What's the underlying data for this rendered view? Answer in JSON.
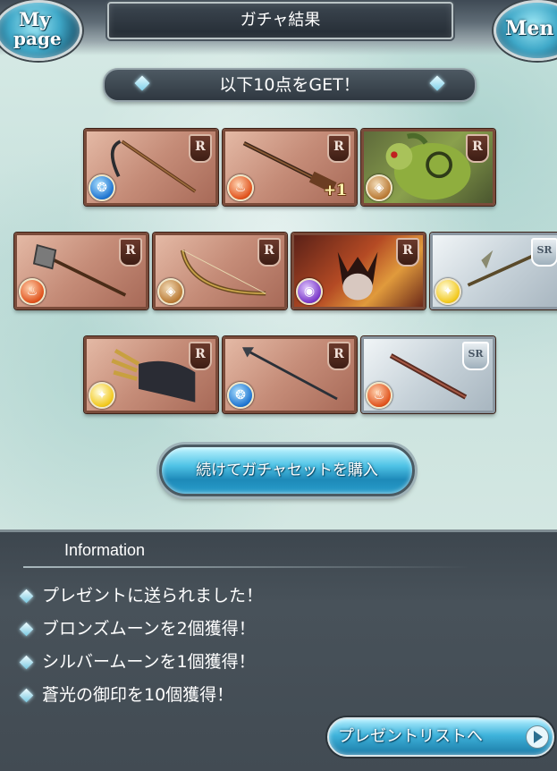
{
  "header": {
    "title": "ガチャ結果",
    "mypage_line1": "My",
    "mypage_line2": "page",
    "menu_label": "Men"
  },
  "banner": {
    "text": "以下10点をGET！"
  },
  "cards": [
    {
      "rank": "R",
      "element": "water",
      "element_icon": "water-icon",
      "art": "scythe"
    },
    {
      "rank": "R",
      "element": "fire",
      "element_icon": "fire-icon",
      "art": "gun",
      "plus": "+1"
    },
    {
      "rank": "R",
      "element": "earth",
      "element_icon": "earth-icon",
      "art": "green-beast"
    },
    {
      "rank": "R",
      "element": "fire",
      "element_icon": "fire-icon",
      "art": "axe"
    },
    {
      "rank": "R",
      "element": "earth",
      "element_icon": "earth-icon",
      "art": "bow"
    },
    {
      "rank": "R",
      "element": "dark",
      "element_icon": "dark-icon",
      "art": "horned-beast"
    },
    {
      "rank": "SR",
      "element": "light",
      "element_icon": "light-icon",
      "art": "staff"
    },
    {
      "rank": "R",
      "element": "light",
      "element_icon": "light-icon",
      "art": "gauntlet"
    },
    {
      "rank": "R",
      "element": "water",
      "element_icon": "water-icon",
      "art": "spear"
    },
    {
      "rank": "SR",
      "element": "fire",
      "element_icon": "fire-icon",
      "art": "rifle"
    }
  ],
  "buy_button": {
    "label": "続けてガチャセットを購入"
  },
  "info": {
    "title": "Information",
    "items": [
      "プレゼントに送られました！",
      "ブロンズムーンを2個獲得！",
      "シルバームーンを1個獲得！",
      "蒼光の御印を10個獲得！"
    ],
    "present_button": "プレゼントリストへ"
  },
  "colors": {
    "r_card": "#c58c78",
    "sr_card": "#c8d3da",
    "button_accent": "#4fc3e6",
    "panel_bg": "#48525a"
  }
}
